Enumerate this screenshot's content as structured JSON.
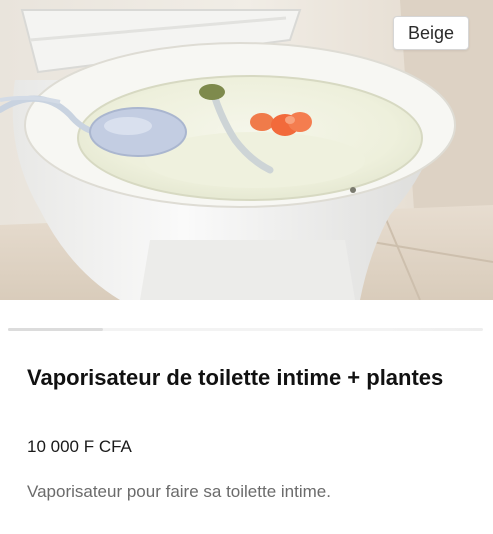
{
  "product": {
    "variant_badge": "Beige",
    "title": "Vaporisateur de toilette intime + plantes",
    "price": "10 000 F CFA",
    "description": "Vaporisateur pour faire sa toilette intime."
  }
}
